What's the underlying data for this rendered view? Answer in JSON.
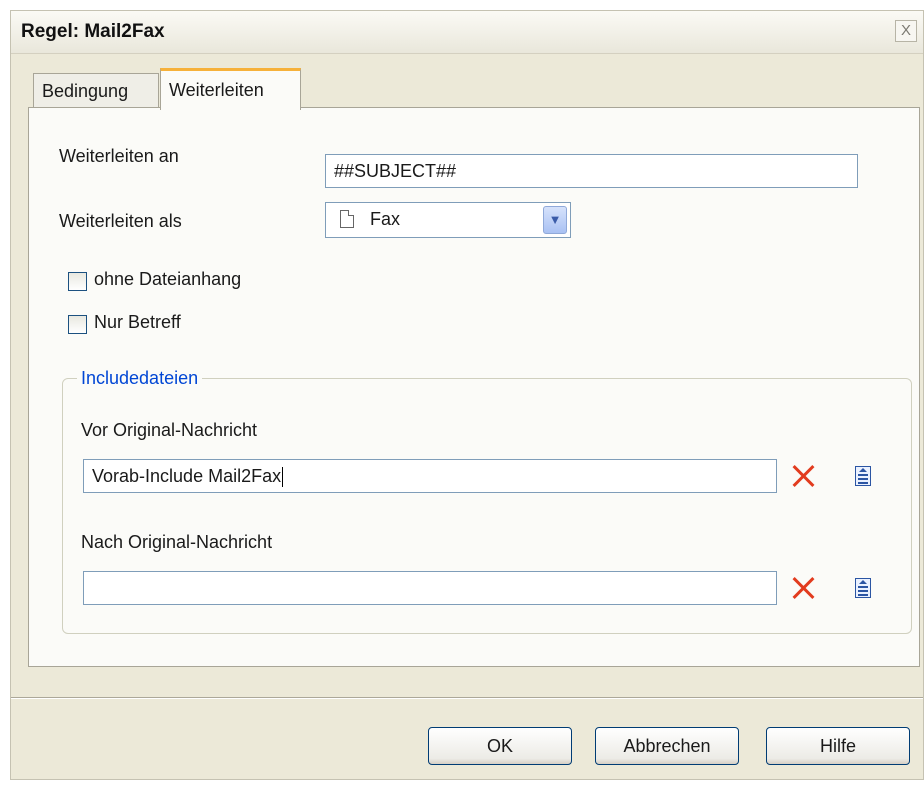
{
  "dialog": {
    "title": "Regel: Mail2Fax",
    "close_glyph": "X"
  },
  "tabs": [
    {
      "label": "Bedingung",
      "active": false
    },
    {
      "label": "Weiterleiten",
      "active": true
    }
  ],
  "form": {
    "forward_to_label": "Weiterleiten an",
    "forward_to_value": "##SUBJECT##",
    "forward_as_label": "Weiterleiten als",
    "forward_as_value": "Fax",
    "forward_as_icon": "document-icon",
    "no_attachment_label": "ohne Dateianhang",
    "no_attachment_checked": false,
    "subject_only_label": "Nur Betreff",
    "subject_only_checked": false
  },
  "includes": {
    "legend": "Includedateien",
    "before_label": "Vor Original-Nachricht",
    "before_value": "Vorab-Include Mail2Fax",
    "after_label": "Nach Original-Nachricht",
    "after_value": "",
    "clear_icon": "delete-x-icon",
    "pick_icon": "file-pick-icon"
  },
  "buttons": {
    "ok": "OK",
    "cancel": "Abbrechen",
    "help": "Hilfe"
  },
  "colors": {
    "window_bg": "#ece9d8",
    "active_tab_accent": "#f6b13a",
    "legend_text": "#0046d5",
    "delete_icon": "#e23b1e"
  }
}
